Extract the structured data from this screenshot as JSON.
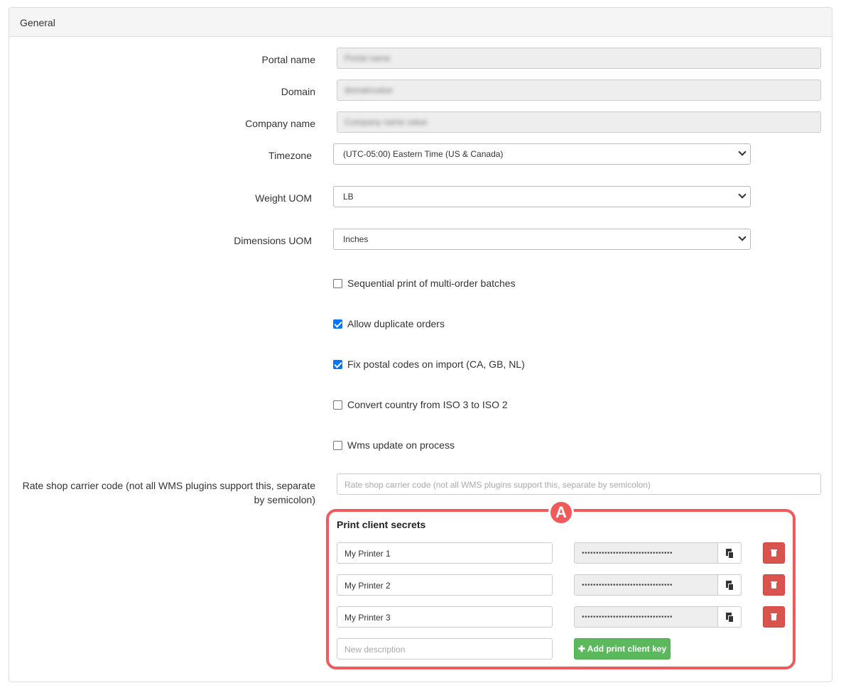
{
  "panel": {
    "title": "General"
  },
  "fields": {
    "portal_name": {
      "label": "Portal name",
      "value": "Portal name"
    },
    "domain": {
      "label": "Domain",
      "value": "domainvalue"
    },
    "company_name": {
      "label": "Company name",
      "value": "Company name value"
    },
    "timezone": {
      "label": "Timezone",
      "value": "(UTC-05:00) Eastern Time (US & Canada)"
    },
    "weight_uom": {
      "label": "Weight UOM",
      "value": "LB"
    },
    "dimensions_uom": {
      "label": "Dimensions UOM",
      "value": "Inches"
    }
  },
  "checkboxes": [
    {
      "label": "Sequential print of multi-order batches",
      "checked": false
    },
    {
      "label": "Allow duplicate orders",
      "checked": true
    },
    {
      "label": "Fix postal codes on import (CA, GB, NL)",
      "checked": true
    },
    {
      "label": "Convert country from ISO 3 to ISO 2",
      "checked": false
    },
    {
      "label": "Wms update on process",
      "checked": false
    }
  ],
  "rate_shop": {
    "label": "Rate shop carrier code (not all WMS plugins support this, separate by semicolon)",
    "placeholder": "Rate shop carrier code (not all WMS plugins support this, separate by semicolon)"
  },
  "print_secrets": {
    "title": "Print client secrets",
    "items": [
      {
        "name": "My Printer 1",
        "secret": "••••••••••••••••••••••••••••••••"
      },
      {
        "name": "My Printer 2",
        "secret": "••••••••••••••••••••••••••••••••"
      },
      {
        "name": "My Printer 3",
        "secret": "••••••••••••••••••••••••••••••••"
      }
    ],
    "new_placeholder": "New description",
    "add_label": "✚ Add print client key"
  },
  "annotation": {
    "badge": "A",
    "color": "#f05a5a"
  },
  "colors": {
    "checkbox_checked": "#0075ff",
    "danger": "#d9534f",
    "success": "#5cb85c"
  }
}
